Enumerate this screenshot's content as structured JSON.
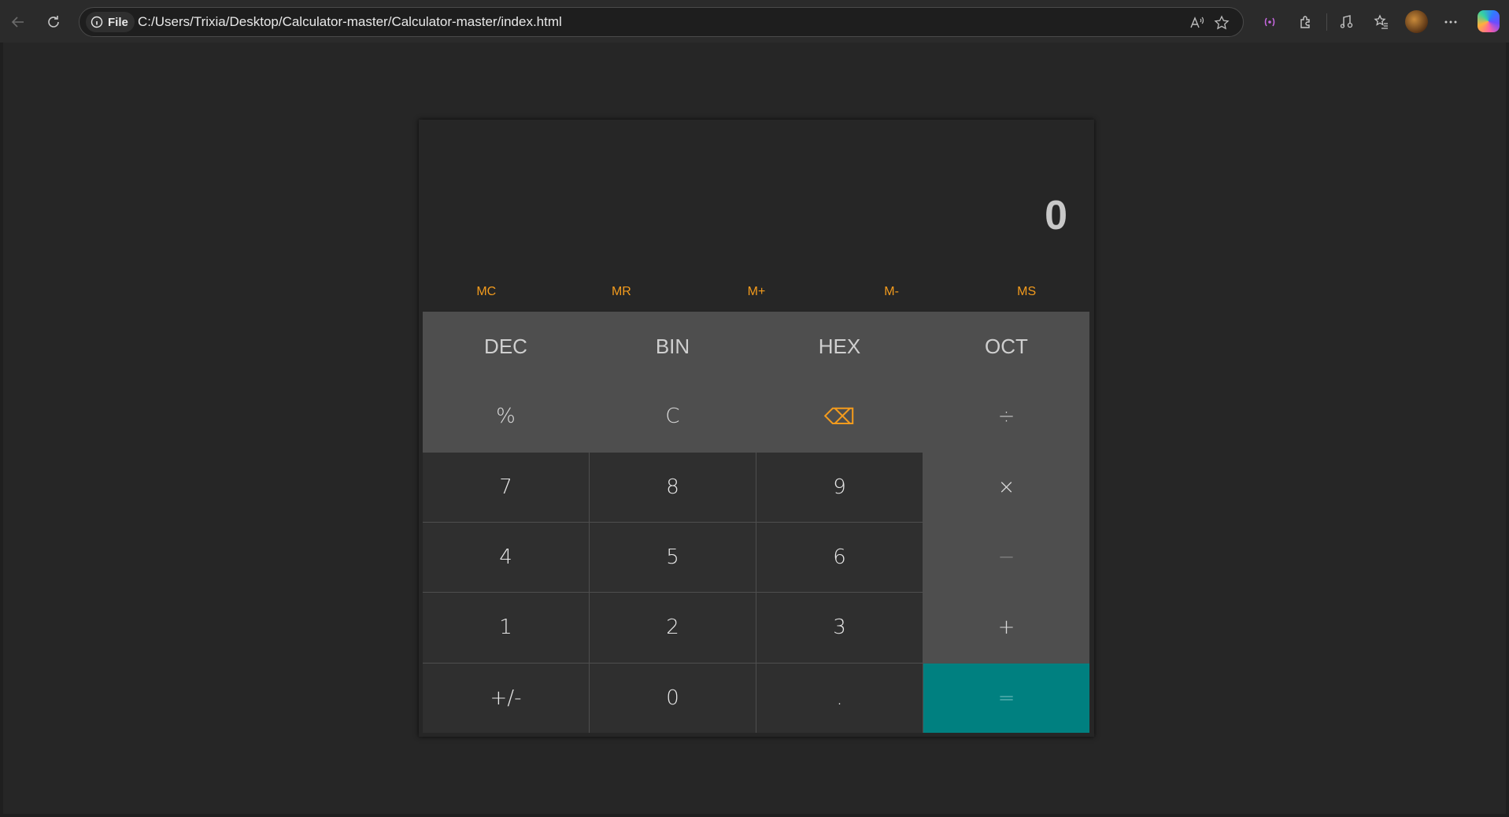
{
  "browser": {
    "site_label": "File",
    "url": "C:/Users/Trixia/Desktop/Calculator-master/Calculator-master/index.html"
  },
  "calculator": {
    "display": "0",
    "memory": [
      "MC",
      "MR",
      "M+",
      "M-",
      "MS"
    ],
    "modes": [
      "DEC",
      "BIN",
      "HEX",
      "OCT"
    ],
    "functions": {
      "percent": "%",
      "clear": "C",
      "backspace": "⌫",
      "divide": "÷"
    },
    "keys": {
      "seven": "7",
      "eight": "8",
      "nine": "9",
      "multiply": "×",
      "four": "4",
      "five": "5",
      "six": "6",
      "minus": "−",
      "one": "1",
      "two": "2",
      "three": "3",
      "plus": "+",
      "negate": "+/-",
      "zero": "0",
      "decimal": ".",
      "equals": "="
    }
  },
  "colors": {
    "accent_orange": "#f39b1d",
    "equals_teal": "#008080",
    "page_bg": "#262626"
  }
}
